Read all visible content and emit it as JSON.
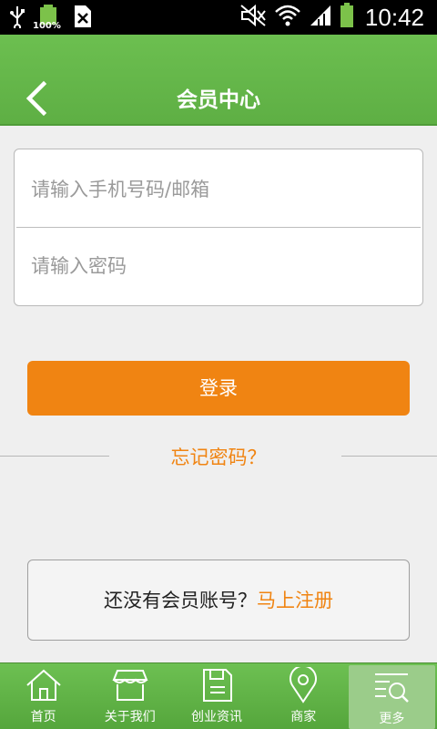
{
  "status_bar": {
    "battery_percent": "100%",
    "time": "10:42",
    "icons": [
      "usb-icon",
      "battery-charging-icon",
      "sim-icon",
      "mute-icon",
      "wifi-icon",
      "signal-icon",
      "battery-icon"
    ]
  },
  "header": {
    "title": "会员中心",
    "back_icon": "chevron-left-icon"
  },
  "form": {
    "account_placeholder": "请输入手机号码/邮箱",
    "account_value": "",
    "password_placeholder": "请输入密码",
    "password_value": ""
  },
  "login_button": "登录",
  "forgot_password": "忘记密码？",
  "register": {
    "prompt": "还没有会员账号？",
    "link": "马上注册"
  },
  "tabs": [
    {
      "label": "首页",
      "icon": "home-icon"
    },
    {
      "label": "关于我们",
      "icon": "shop-icon"
    },
    {
      "label": "创业资讯",
      "icon": "document-icon"
    },
    {
      "label": "商家",
      "icon": "location-pin-icon"
    },
    {
      "label": "更多",
      "icon": "search-list-icon",
      "active": true
    }
  ],
  "colors": {
    "header_green": "#66b64c",
    "accent_orange": "#f08412",
    "background": "#efefef"
  }
}
